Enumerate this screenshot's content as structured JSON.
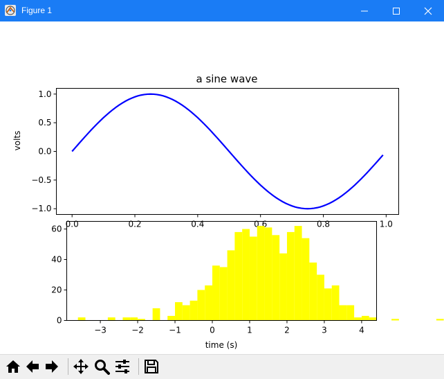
{
  "window": {
    "title": "Figure 1"
  },
  "toolbar": {
    "buttons": [
      "home-icon",
      "back-icon",
      "forward-icon",
      "pan-icon",
      "zoom-icon",
      "configure-subplots-icon",
      "save-icon"
    ]
  },
  "colors": {
    "titlebar": "#1a7cf5",
    "sine_line": "#0000ff",
    "hist_bars": "#ffff00"
  },
  "chart_data": [
    {
      "type": "line",
      "title": "a sine wave",
      "xlabel": "",
      "ylabel": "volts",
      "xlim": [
        -0.05,
        1.04
      ],
      "ylim": [
        -1.1,
        1.1
      ],
      "xticks": [
        "0.0",
        "0.2",
        "0.4",
        "0.6",
        "0.8",
        "1.0"
      ],
      "yticks": [
        "−1.0",
        "−0.5",
        "0.0",
        "0.5",
        "1.0"
      ],
      "grid": false,
      "series": [
        {
          "function": "sin(2*pi*t)",
          "x_start": 0.0,
          "x_end": 0.99,
          "x_step": 0.01
        }
      ]
    },
    {
      "type": "bar",
      "title": "",
      "xlabel": "time (s)",
      "ylabel": "",
      "xlim": [
        -3.9,
        4.4
      ],
      "ylim": [
        0,
        65
      ],
      "xticks": [
        "−3",
        "−2",
        "−1",
        "0",
        "1",
        "2",
        "3",
        "4"
      ],
      "yticks": [
        "0",
        "20",
        "40",
        "60"
      ],
      "grid": false,
      "bin_start": -3.6,
      "bin_width": 0.2,
      "counts": [
        2,
        0,
        0,
        0,
        2,
        0,
        2,
        2,
        1,
        0,
        8,
        0,
        3,
        12,
        10,
        13,
        20,
        23,
        36,
        35,
        46,
        58,
        60,
        55,
        62,
        61,
        56,
        44,
        58,
        62,
        54,
        38,
        30,
        21,
        23,
        10,
        10,
        2,
        3,
        2,
        0,
        0,
        1,
        0,
        0,
        0,
        0,
        0,
        1,
        0,
        0,
        1
      ]
    }
  ]
}
